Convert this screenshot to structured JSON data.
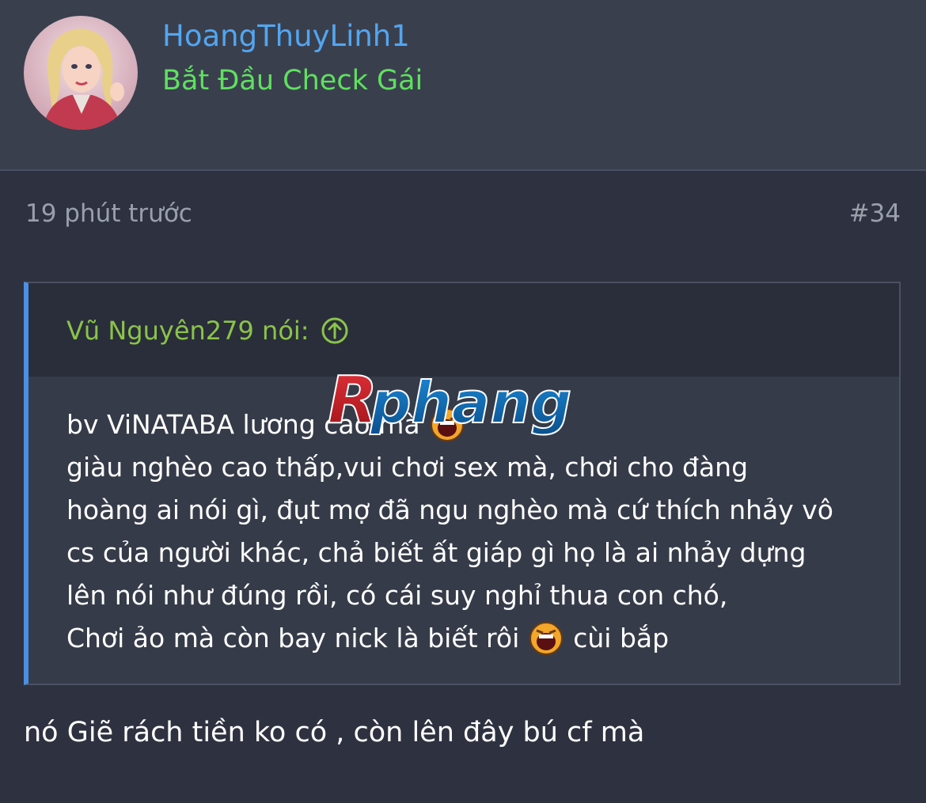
{
  "post": {
    "author": {
      "username": "HoangThuyLinh1",
      "title": "Bắt Đầu Check Gái"
    },
    "time": "19 phút trước",
    "number": "#34",
    "quote": {
      "author_label": "Vũ Nguyên279 nói:",
      "lines": [
        "bv ViNATABA lương cao mà",
        "giàu nghèo cao thấp,vui chơi sex mà, chơi cho đàng",
        "hoàng ai nói gì, đụt mợ đã ngu nghèo mà cứ thích nhảy vô",
        "cs của người khác, chả biết ất giáp gì họ là ai nhảy dựng",
        "lên nói như đúng rồi, có cái suy nghỉ thua con chó,",
        "Chơi ảo mà còn bay nick là biết rôi",
        "cùi bắp"
      ]
    },
    "reply": "nó Giẽ rách tiền ko có , còn lên đây bú cf mà"
  },
  "watermark": {
    "text": "Rphang"
  },
  "icons": {
    "quote_jump": "arrow-up-circle-icon",
    "emoji": "laugh-emoji-icon"
  },
  "colors": {
    "username": "#52a6f0",
    "user_title": "#5fe05f",
    "quote_author": "#8bc34a",
    "quote_border": "#4a90e2"
  }
}
